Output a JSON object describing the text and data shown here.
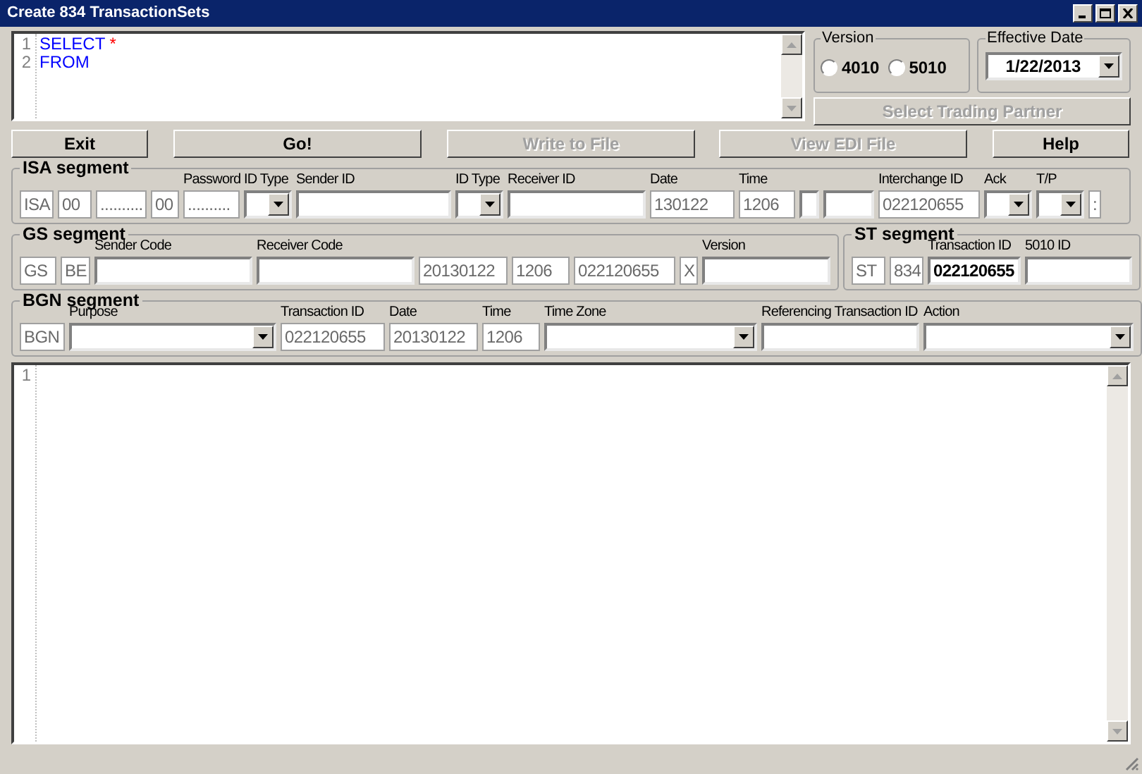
{
  "window": {
    "title": "Create 834 TransactionSets"
  },
  "query_editor": {
    "lines": [
      {
        "number": "1",
        "tokens": [
          {
            "text": "SELECT",
            "color": "#0000ff"
          },
          {
            "text": "*",
            "color": "#ff0000"
          }
        ]
      },
      {
        "number": "2",
        "tokens": [
          {
            "text": "FROM",
            "color": "#0000ff"
          }
        ]
      }
    ]
  },
  "version": {
    "title": "Version",
    "options": [
      {
        "label": "4010",
        "selected": false
      },
      {
        "label": "5010",
        "selected": false
      }
    ]
  },
  "effective_date": {
    "title": "Effective Date",
    "value": "1/22/2013"
  },
  "select_trading_partner": {
    "label": "Select Trading Partner",
    "disabled": true
  },
  "buttons": [
    {
      "label": "Exit",
      "disabled": false
    },
    {
      "label": "Go!",
      "disabled": false
    },
    {
      "label": "Write to File",
      "disabled": true
    },
    {
      "label": "View EDI File",
      "disabled": true
    },
    {
      "label": "Help",
      "disabled": false
    }
  ],
  "segments": [
    {
      "title": "ISA segment",
      "fields": [
        {
          "kind": "text",
          "value": "ISA",
          "disabled": true
        },
        {
          "kind": "text",
          "value": "00",
          "disabled": true
        },
        {
          "kind": "text",
          "value": "..........",
          "disabled": true
        },
        {
          "kind": "text",
          "value": "00",
          "disabled": true
        },
        {
          "kind": "text",
          "label": "Password",
          "value": "..........",
          "disabled": true
        },
        {
          "kind": "select",
          "label": "ID Type"
        },
        {
          "kind": "text",
          "label": "Sender ID",
          "disabled": false
        },
        {
          "kind": "select",
          "label": "ID Type"
        },
        {
          "kind": "text",
          "label": "Receiver ID",
          "disabled": false
        },
        {
          "kind": "text",
          "label": "Date",
          "value": "130122",
          "disabled": true
        },
        {
          "kind": "text",
          "label": "Time",
          "value": "1206",
          "disabled": true
        },
        {
          "kind": "text",
          "disabled": false
        },
        {
          "kind": "text",
          "disabled": false
        },
        {
          "kind": "text",
          "label": "Interchange ID",
          "value": "022120655",
          "disabled": true
        },
        {
          "kind": "select",
          "label": "Ack"
        },
        {
          "kind": "select",
          "label": "T/P"
        },
        {
          "kind": "text",
          "value": ":",
          "disabled": true
        }
      ]
    },
    {
      "title": "GS segment",
      "fields": [
        {
          "kind": "text",
          "value": "GS",
          "disabled": true
        },
        {
          "kind": "text",
          "value": "BE",
          "disabled": true
        },
        {
          "kind": "text",
          "label": "Sender Code",
          "disabled": false
        },
        {
          "kind": "text",
          "label": "Receiver Code",
          "disabled": false
        },
        {
          "kind": "text",
          "value": "20130122",
          "disabled": true
        },
        {
          "kind": "text",
          "value": "1206",
          "disabled": true
        },
        {
          "kind": "text",
          "value": "022120655",
          "disabled": true
        },
        {
          "kind": "text",
          "value": "X",
          "disabled": true
        },
        {
          "kind": "text",
          "label": "Version",
          "disabled": false
        }
      ]
    },
    {
      "title": "ST segment",
      "fields": [
        {
          "kind": "text",
          "value": "ST",
          "disabled": true
        },
        {
          "kind": "text",
          "value": "834",
          "disabled": true
        },
        {
          "kind": "text",
          "label": "Transaction ID",
          "value": "022120655",
          "disabled": false
        },
        {
          "kind": "text",
          "label": "5010 ID",
          "disabled": false
        }
      ]
    },
    {
      "title": "BGN segment",
      "fields": [
        {
          "kind": "text",
          "value": "BGN",
          "disabled": true
        },
        {
          "kind": "select",
          "label": "Purpose"
        },
        {
          "kind": "text",
          "label": "Transaction ID",
          "value": "022120655",
          "disabled": true
        },
        {
          "kind": "text",
          "label": "Date",
          "value": "20130122",
          "disabled": true
        },
        {
          "kind": "text",
          "label": "Time",
          "value": "1206",
          "disabled": true
        },
        {
          "kind": "select",
          "label": "Time Zone"
        },
        {
          "kind": "text",
          "label": "Referencing Transaction ID",
          "disabled": false
        },
        {
          "kind": "select",
          "label": "Action"
        }
      ]
    }
  ],
  "output_editor": {
    "lines": [
      {
        "number": "1"
      }
    ]
  }
}
